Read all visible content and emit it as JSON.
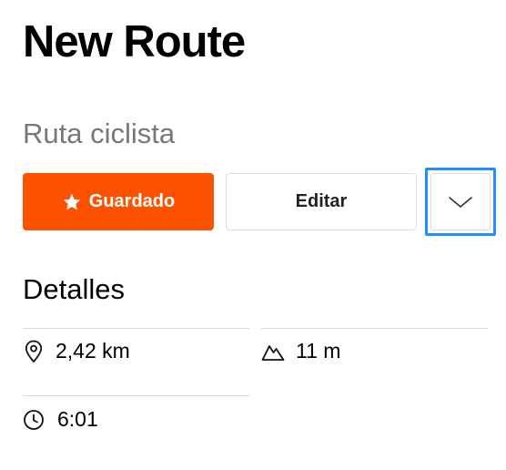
{
  "route": {
    "title": "New Route",
    "type": "Ruta ciclista"
  },
  "actions": {
    "saved_label": "Guardado",
    "edit_label": "Editar"
  },
  "details": {
    "heading": "Detalles",
    "distance": "2,42 km",
    "elevation": "11 m",
    "time": "6:01"
  },
  "colors": {
    "accent": "#fc5200",
    "focus_ring": "#1e90ff"
  },
  "icons": {
    "saved": "star-icon",
    "more": "chevron-down-icon",
    "distance": "location-pin-icon",
    "elevation": "mountain-icon",
    "time": "clock-icon"
  }
}
